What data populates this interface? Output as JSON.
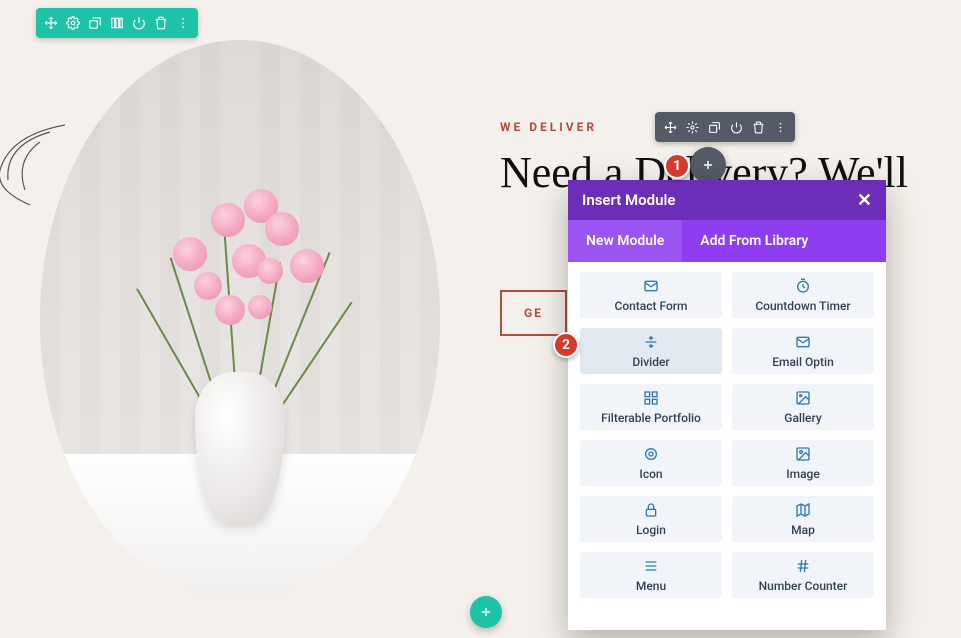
{
  "section_toolbar": {
    "icons": [
      "move-icon",
      "settings-icon",
      "duplicate-icon",
      "columns-icon",
      "power-icon",
      "trash-icon",
      "more-icon"
    ]
  },
  "row_toolbar": {
    "icons": [
      "move-icon",
      "settings-icon",
      "duplicate-icon",
      "power-icon",
      "trash-icon",
      "more-icon"
    ]
  },
  "hero": {
    "kicker": "WE DELIVER",
    "headline": "Need a Delivery? We'll"
  },
  "cta": {
    "label": "GE"
  },
  "modal": {
    "title": "Insert Module",
    "tabs": [
      {
        "label": "New Module",
        "active": true
      },
      {
        "label": "Add From Library",
        "active": false
      }
    ],
    "modules": [
      {
        "name": "contact-form",
        "label": "Contact Form",
        "icon": "mail-icon"
      },
      {
        "name": "countdown-timer",
        "label": "Countdown Timer",
        "icon": "timer-icon"
      },
      {
        "name": "divider",
        "label": "Divider",
        "icon": "divider-icon",
        "hover": true
      },
      {
        "name": "email-optin",
        "label": "Email Optin",
        "icon": "mail-icon"
      },
      {
        "name": "filterable-portfolio",
        "label": "Filterable Portfolio",
        "icon": "grid-icon"
      },
      {
        "name": "gallery",
        "label": "Gallery",
        "icon": "gallery-icon"
      },
      {
        "name": "icon",
        "label": "Icon",
        "icon": "target-icon"
      },
      {
        "name": "image",
        "label": "Image",
        "icon": "image-icon"
      },
      {
        "name": "login",
        "label": "Login",
        "icon": "lock-icon"
      },
      {
        "name": "map",
        "label": "Map",
        "icon": "map-icon"
      },
      {
        "name": "menu",
        "label": "Menu",
        "icon": "menu-icon"
      },
      {
        "name": "number-counter",
        "label": "Number Counter",
        "icon": "hash-icon"
      }
    ]
  },
  "steps": {
    "one": "1",
    "two": "2"
  },
  "image": {
    "description": "pink ranunculus flowers in white vase on white table against cream curtain"
  }
}
